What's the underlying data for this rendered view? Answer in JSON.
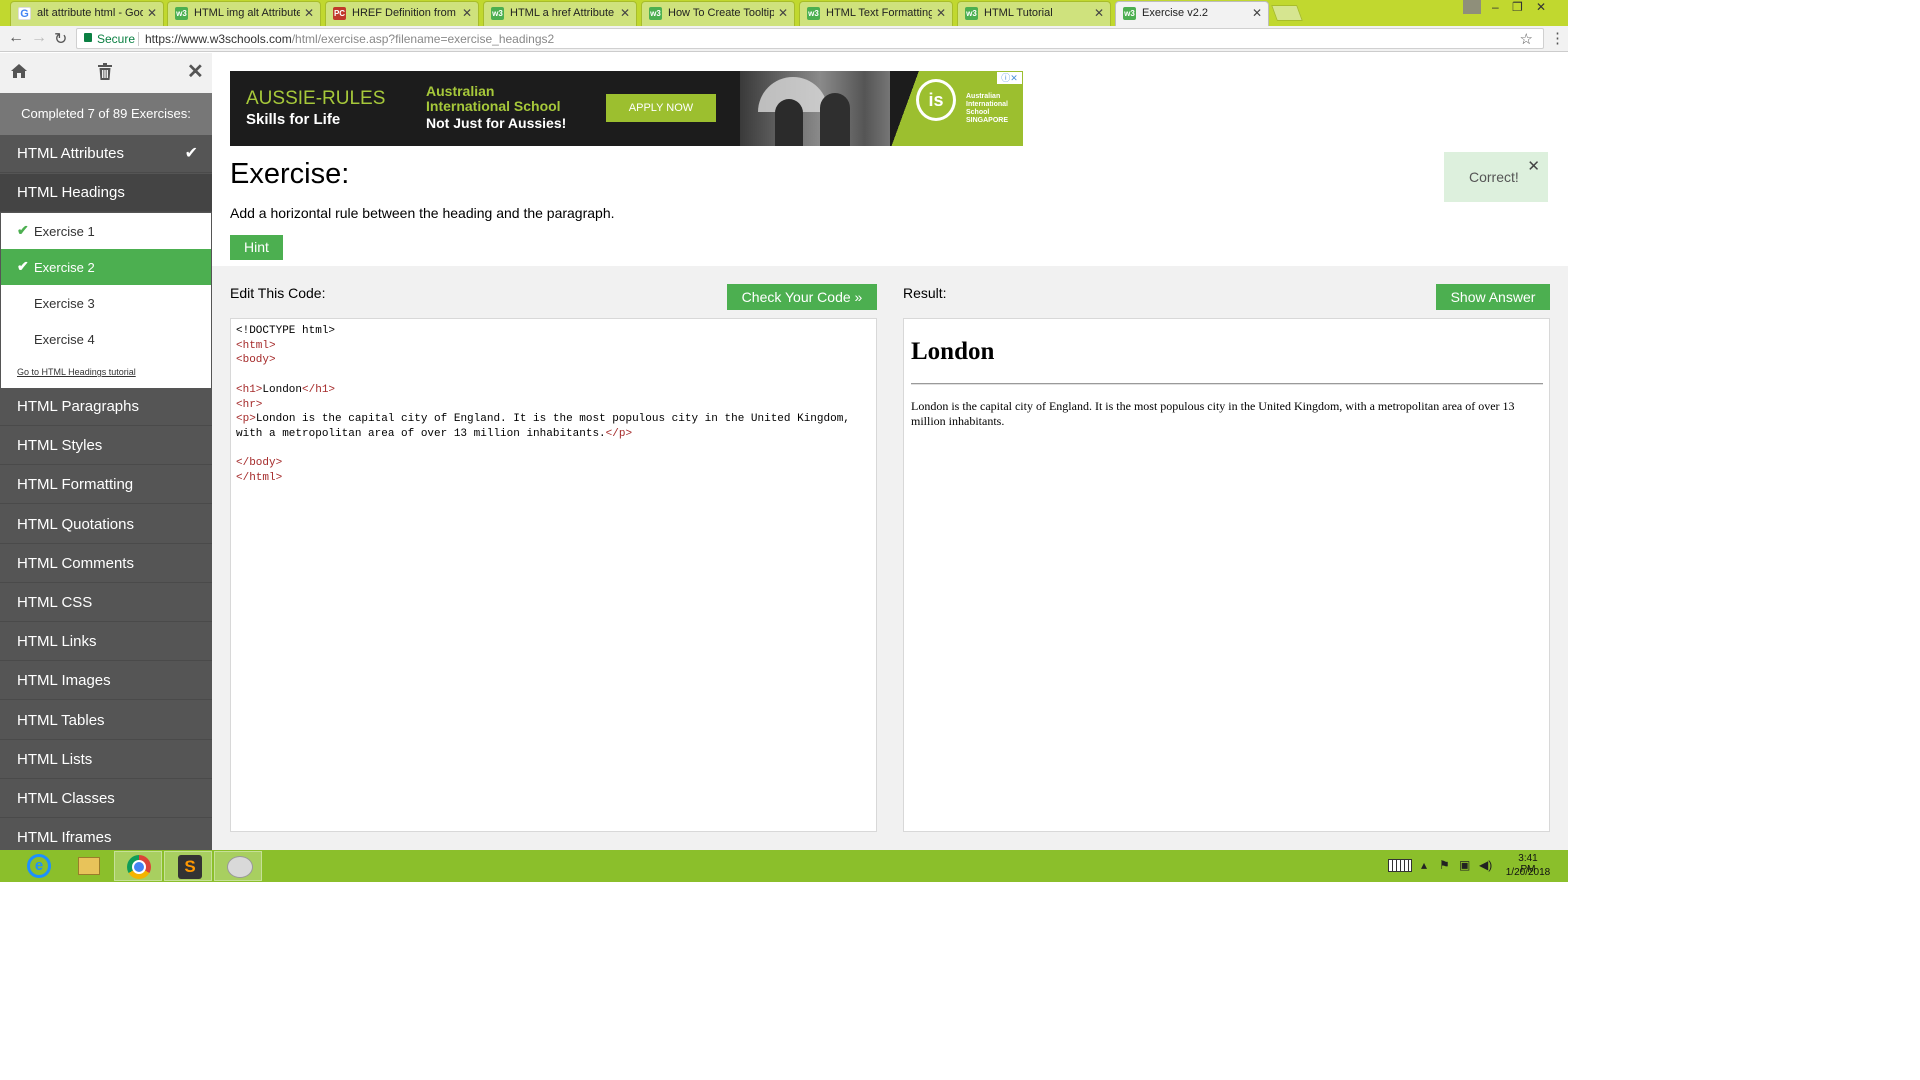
{
  "browser": {
    "tabs": [
      {
        "title": "alt attribute html - Goog",
        "favicon": "google-icon"
      },
      {
        "title": "HTML img alt Attribute",
        "favicon": "w3schools-icon"
      },
      {
        "title": "HREF Definition from PC",
        "favicon": "pcmag-icon"
      },
      {
        "title": "HTML a href Attribute",
        "favicon": "w3schools-icon"
      },
      {
        "title": "How To Create Tooltips",
        "favicon": "w3schools-icon"
      },
      {
        "title": "HTML Text Formatting",
        "favicon": "w3schools-icon"
      },
      {
        "title": "HTML Tutorial",
        "favicon": "w3schools-icon"
      },
      {
        "title": "Exercise v2.2",
        "favicon": "w3schools-icon"
      }
    ],
    "security_label": "Secure",
    "url_host": "https://www.w3schools.com",
    "url_path": "/html/exercise.asp?filename=exercise_headings2",
    "window_controls": [
      "–",
      "❐",
      "✕"
    ]
  },
  "sidebar": {
    "completed_text": "Completed 7 of 89 Exercises:",
    "categories_before": [
      {
        "label": "HTML Attributes",
        "completed": true
      },
      {
        "label": "HTML Headings",
        "completed": false,
        "open": true
      }
    ],
    "exercises": [
      {
        "label": "Exercise 1",
        "completed": true,
        "current": false
      },
      {
        "label": "Exercise 2",
        "completed": true,
        "current": true
      },
      {
        "label": "Exercise 3",
        "completed": false,
        "current": false
      },
      {
        "label": "Exercise 4",
        "completed": false,
        "current": false
      }
    ],
    "tutorial_link": "Go to HTML Headings tutorial",
    "categories_after": [
      "HTML Paragraphs",
      "HTML Styles",
      "HTML Formatting",
      "HTML Quotations",
      "HTML Comments",
      "HTML CSS",
      "HTML Links",
      "HTML Images",
      "HTML Tables",
      "HTML Lists",
      "HTML Classes",
      "HTML Iframes"
    ]
  },
  "ad": {
    "line1": "AUSSIE-RULES",
    "line2": "Skills for Life",
    "school": "Australian International School",
    "tagline": "Not Just for Aussies!",
    "cta": "APPLY NOW",
    "logo_text": "Australian International School SINGAPORE",
    "logo_mark": "is",
    "adchoices": "ⓘ✕"
  },
  "exercise": {
    "title": "Exercise:",
    "instructions": "Add a horizontal rule between the heading and the paragraph.",
    "hint_label": "Hint",
    "feedback": "Correct!",
    "edit_label": "Edit This Code:",
    "check_label": "Check Your Code »",
    "result_label": "Result:",
    "answer_label": "Show Answer",
    "code_lines": [
      [
        {
          "t": "<!DOCTYPE html>",
          "tag": false
        }
      ],
      [
        {
          "t": "<html>",
          "tag": true
        }
      ],
      [
        {
          "t": "<body>",
          "tag": true
        }
      ],
      [
        {
          "t": "",
          "tag": false
        }
      ],
      [
        {
          "t": "<h1>",
          "tag": true
        },
        {
          "t": "London",
          "tag": false
        },
        {
          "t": "</h1>",
          "tag": true
        }
      ],
      [
        {
          "t": "<hr>",
          "tag": true
        }
      ],
      [
        {
          "t": "<p>",
          "tag": true
        },
        {
          "t": "London is the capital city of England. It is the most populous city in the United Kingdom,",
          "tag": false
        }
      ],
      [
        {
          "t": "with a metropolitan area of over 13 million inhabitants.",
          "tag": false
        },
        {
          "t": "</p>",
          "tag": true
        }
      ],
      [
        {
          "t": "",
          "tag": false
        }
      ],
      [
        {
          "t": "</body>",
          "tag": true
        }
      ],
      [
        {
          "t": "</html>",
          "tag": true
        }
      ]
    ],
    "result_heading": "London",
    "result_paragraph": "London is the capital city of England. It is the most populous city in the United Kingdom, with a metropolitan area of over 13 million inhabitants."
  },
  "taskbar": {
    "apps": [
      "internet-explorer-icon",
      "file-explorer-icon",
      "chrome-icon",
      "sublime-text-icon",
      "paint-icon"
    ],
    "time": "3:41 PM",
    "date": "1/20/2018"
  },
  "colors": {
    "accent_green": "#4caf50",
    "sidebar_bg": "#555555",
    "tabstrip": "#c1d82f",
    "taskbar": "#8bbf2b"
  }
}
